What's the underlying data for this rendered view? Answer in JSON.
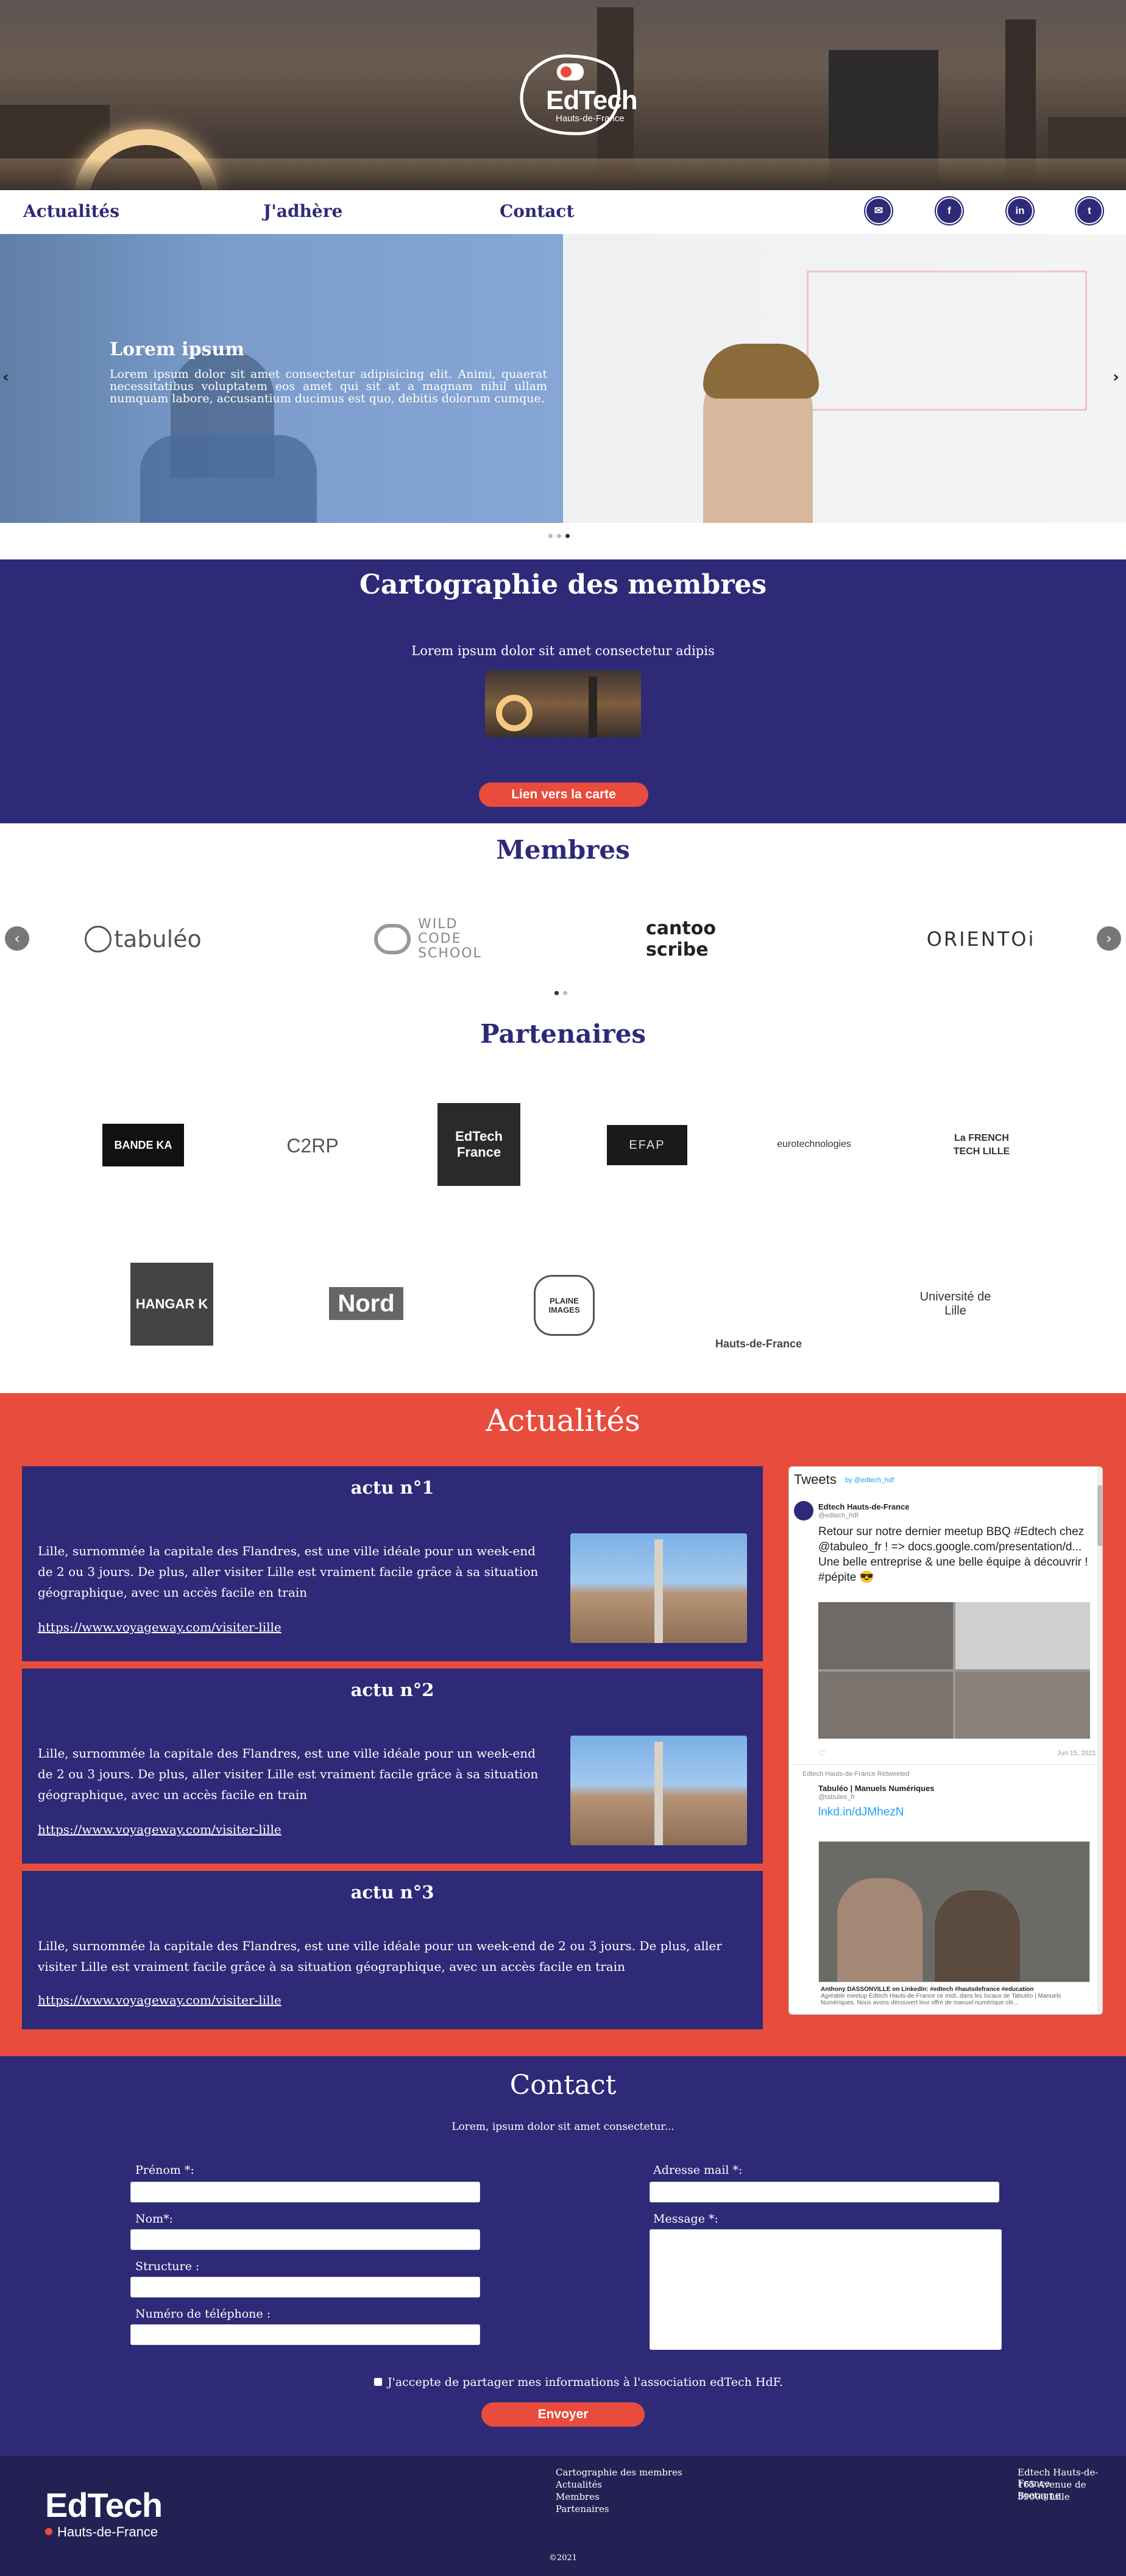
{
  "brand": {
    "name": "EdTech",
    "region": "Hauts-de-France"
  },
  "nav": {
    "items": [
      "Actualités",
      "J'adhère",
      "Contact"
    ]
  },
  "social": [
    "envelope-icon",
    "facebook-icon",
    "linkedin-icon",
    "twitter-icon"
  ],
  "carousel": {
    "title": "Lorem ipsum",
    "text": "Lorem ipsum dolor sit amet consectetur adipisicing elit. Animi, quaerat necessitatibus voluptatem eos amet qui sit at a magnam nihil ullam numquam labore, accusantium ducimus est quo, debitis dolorum cumque.",
    "prev": "‹",
    "next": "›",
    "slides": 3,
    "active": 2
  },
  "carto": {
    "title": "Cartographie des membres",
    "text": "Lorem ipsum dolor sit amet consectetur adipis",
    "button": "Lien vers la carte"
  },
  "membres": {
    "title": "Membres",
    "logos": [
      "tabuléo",
      "WILD CODE SCHOOL",
      "cantoo scribe",
      "ORIENTOi"
    ],
    "pages": 2,
    "active": 0
  },
  "partenaires": {
    "title": "Partenaires",
    "row1": [
      "BANDE KA",
      "C2RP",
      "EdTech France",
      "EFAP",
      "eurotechnologies",
      "La FRENCH TECH LILLE"
    ],
    "row2": [
      "HANGAR K",
      "Nord",
      "PLAINE IMAGES",
      "Hauts-de-France",
      "Université de Lille"
    ]
  },
  "actualites": {
    "title": "Actualités",
    "cards": [
      {
        "title": "actu n°1",
        "text": "Lille, surnommée la capitale des Flandres, est une ville idéale pour un week-end de 2 ou 3 jours. De plus, aller visiter Lille est vraiment facile grâce à sa situation géographique, avec un accès facile en train",
        "link": "https://www.voyageway.com/visiter-lille"
      },
      {
        "title": "actu n°2",
        "text": "Lille, surnommée la capitale des Flandres, est une ville idéale pour un week-end de 2 ou 3 jours. De plus, aller visiter Lille est vraiment facile grâce à sa situation géographique, avec un accès facile en train",
        "link": "https://www.voyageway.com/visiter-lille"
      },
      {
        "title": "actu n°3",
        "text": "Lille, surnommée la capitale des Flandres, est une ville idéale pour un week-end de 2 ou 3 jours. De plus, aller visiter Lille est vraiment facile grâce à sa situation géographique, avec un accès facile en train",
        "link": "https://www.voyageway.com/visiter-lille"
      }
    ]
  },
  "twitter": {
    "header": "Tweets",
    "by": "by @edtech_hdf",
    "t1_name": "Edtech Hauts-de-France",
    "t1_handle": "@edtech_hdf",
    "t1_text": "Retour sur notre dernier meetup BBQ #Edtech chez @tabuleo_fr ! => docs.google.com/presentation/d... Une belle entreprise & une belle équipe à découvrir ! #pépite 😎",
    "t1_date": "Jun 15, 2021",
    "retweet": "Edtech Hauts-de-France Retweeted",
    "t2_name": "Tabuléo | Manuels Numériques",
    "t2_handle": "@tabuleo_fr",
    "t2_link": "lnkd.in/dJMhezN",
    "t2_caption": "Anthony DASSONVILLE on LinkedIn: #edtech #hautsdefrance #education",
    "t2_desc": "Agréable meetup Edtech Hauts-de-France ce midi, dans les locaux de Tabuléo | Manuels Numériques. Nous avons découvert leur offre de manuel numérique clé..."
  },
  "contact": {
    "title": "Contact",
    "subtitle": "Lorem, ipsum dolor sit amet consectetur...",
    "prenom": "Prénom *:",
    "nom": "Nom*:",
    "structure": "Structure :",
    "telephone": "Numéro de téléphone :",
    "email": "Adresse mail *:",
    "message": "Message *:",
    "consent": "J'accepte de partager mes informations à l'association edTech HdF.",
    "submit": "Envoyer"
  },
  "footer": {
    "links": [
      "Cartographie des membres",
      "Actualités",
      "Membres",
      "Partenaires"
    ],
    "address": [
      "Edtech Hauts-de-France",
      "165 Avenue de Bretagne",
      "59000 Lille"
    ],
    "copyright": "©2021"
  },
  "colors": {
    "primary": "#2e2a78",
    "accent": "#e84c3d",
    "footer": "#232153"
  }
}
